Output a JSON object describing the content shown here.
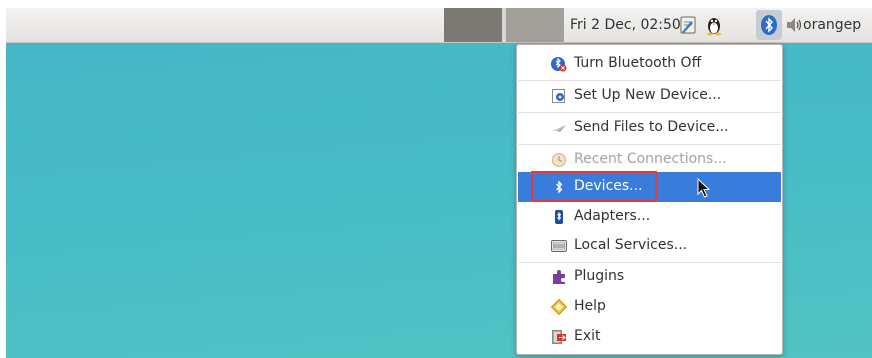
{
  "panel": {
    "clock": "Fri  2 Dec, 02:50",
    "username": "orangep",
    "tray_icons": [
      "notes-icon",
      "tux-icon",
      "bluetooth-icon",
      "volume-icon"
    ]
  },
  "bluetooth_menu": {
    "items": [
      {
        "label": "Turn Bluetooth Off",
        "icon": "bluetooth-off-icon",
        "enabled": true
      },
      {
        "label": "Set Up New Device...",
        "icon": "new-device-icon",
        "enabled": true
      },
      {
        "label": "Send Files to Device...",
        "icon": "send-files-icon",
        "enabled": true
      },
      {
        "label": "Recent Connections...",
        "icon": "recent-connections-icon",
        "enabled": false
      },
      {
        "label": "Devices...",
        "icon": "bluetooth-symbol-icon",
        "enabled": true,
        "selected": true
      },
      {
        "label": "Adapters...",
        "icon": "adapter-icon",
        "enabled": true
      },
      {
        "label": "Local Services...",
        "icon": "local-services-icon",
        "enabled": true
      },
      {
        "label": "Plugins",
        "icon": "plugin-icon",
        "enabled": true
      },
      {
        "label": "Help",
        "icon": "help-icon",
        "enabled": true
      },
      {
        "label": "Exit",
        "icon": "exit-icon",
        "enabled": true
      }
    ]
  },
  "colors": {
    "selection": "#3a7cdc",
    "annotation_box": "#e23b3b",
    "desktop": "#47bcc6"
  }
}
